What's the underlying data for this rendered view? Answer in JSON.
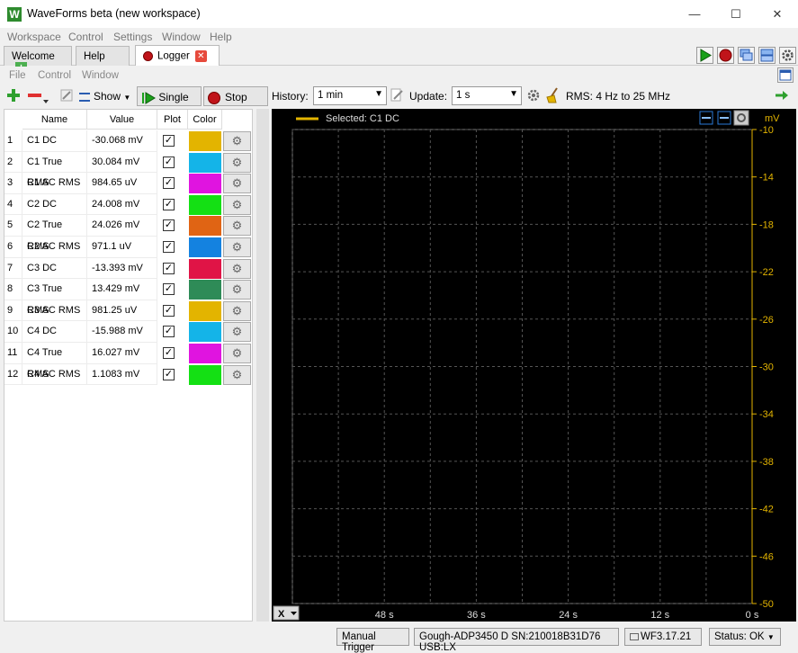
{
  "window": {
    "title": "WaveForms beta (new workspace)",
    "app_icon": "W",
    "minimize": "—",
    "maximize": "☐",
    "close": "✕"
  },
  "menubar": [
    "Workspace",
    "Control",
    "Settings",
    "Window",
    "Help"
  ],
  "tabs": [
    {
      "label": "Welcome"
    },
    {
      "label": "Help"
    },
    {
      "label": "Logger"
    }
  ],
  "submenu": [
    "File",
    "Control",
    "Window"
  ],
  "toolbar": {
    "show_label": "Show",
    "single_label": "Single",
    "stop_label": "Stop",
    "history_label": "History:",
    "history_value": "1 min",
    "update_label": "Update:",
    "update_value": "1 s",
    "rms_label": "RMS: 4 Hz to 25 MHz"
  },
  "table": {
    "headers": [
      "Name",
      "Value",
      "Plot",
      "Color"
    ],
    "rows": [
      {
        "idx": "1",
        "name": "C1 DC",
        "value": "-30.068 mV",
        "color": "#e3b400"
      },
      {
        "idx": "2",
        "name": "C1 True RMS",
        "value": "30.084 mV",
        "color": "#14b4e8"
      },
      {
        "idx": "3",
        "name": "C1 AC RMS",
        "value": "984.65 uV",
        "color": "#e014e0"
      },
      {
        "idx": "4",
        "name": "C2 DC",
        "value": "24.008 mV",
        "color": "#14e014"
      },
      {
        "idx": "5",
        "name": "C2 True RMS",
        "value": "24.026 mV",
        "color": "#e06414"
      },
      {
        "idx": "6",
        "name": "C2 AC RMS",
        "value": "971.1 uV",
        "color": "#1482e0"
      },
      {
        "idx": "7",
        "name": "C3 DC",
        "value": "-13.393 mV",
        "color": "#e01446"
      },
      {
        "idx": "8",
        "name": "C3 True RMS",
        "value": "13.429 mV",
        "color": "#2e8b57"
      },
      {
        "idx": "9",
        "name": "C3 AC RMS",
        "value": "981.25 uV",
        "color": "#e3b400"
      },
      {
        "idx": "10",
        "name": "C4 DC",
        "value": "-15.988 mV",
        "color": "#14b4e8"
      },
      {
        "idx": "11",
        "name": "C4 True RMS",
        "value": "16.027 mV",
        "color": "#e014e0"
      },
      {
        "idx": "12",
        "name": "C4 AC RMS",
        "value": "1.1083 mV",
        "color": "#14e014"
      }
    ]
  },
  "plot": {
    "selected_label": "Selected: C1 DC",
    "unit": "mV",
    "x_selector": "X",
    "y_ticks": [
      "-10",
      "-14",
      "-18",
      "-22",
      "-26",
      "-30",
      "-34",
      "-38",
      "-42",
      "-46",
      "-50"
    ],
    "x_ticks": [
      "48 s",
      "36 s",
      "24 s",
      "12 s",
      "0 s"
    ],
    "ylim": [
      -50,
      -10
    ],
    "xlim": [
      60,
      0
    ]
  },
  "status": {
    "trigger": "Manual Trigger",
    "device": "Gough-ADP3450 D SN:210018B31D76 USB:LX",
    "version": "WF3.17.21",
    "state": "Status: OK"
  }
}
